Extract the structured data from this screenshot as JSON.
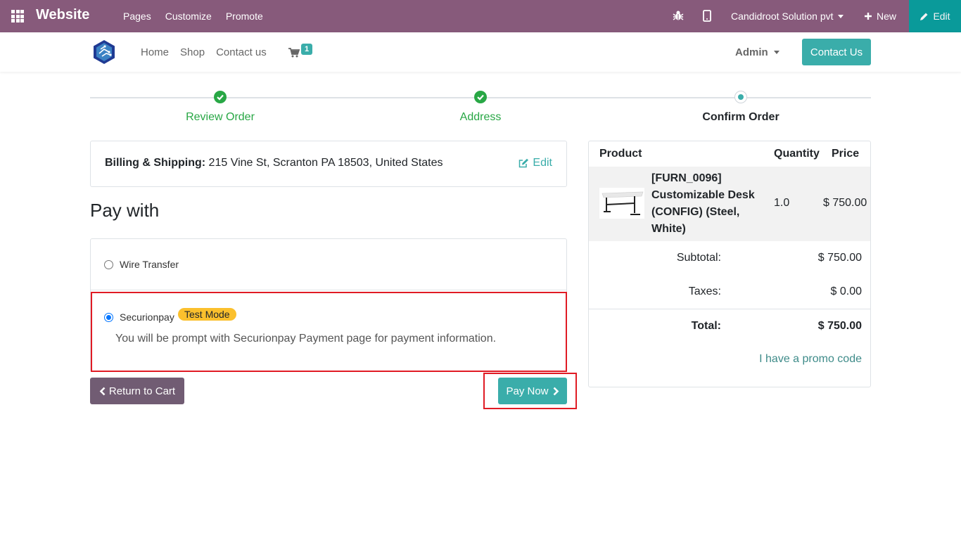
{
  "topbar": {
    "brand": "Website",
    "menu": [
      "Pages",
      "Customize",
      "Promote"
    ],
    "company": "Candidroot Solution pvt",
    "new_label": "New",
    "edit_label": "Edit"
  },
  "navbar": {
    "links": [
      "Home",
      "Shop",
      "Contact us"
    ],
    "cart_count": "1",
    "user": "Admin",
    "contact_button": "Contact Us"
  },
  "steps": [
    {
      "label": "Review Order",
      "state": "done"
    },
    {
      "label": "Address",
      "state": "done"
    },
    {
      "label": "Confirm Order",
      "state": "current"
    }
  ],
  "billing": {
    "title": "Billing & Shipping:",
    "address": "215 Vine St, Scranton PA 18503, United States",
    "edit_label": "Edit"
  },
  "pay_with": {
    "title": "Pay with",
    "options": [
      {
        "label": "Wire Transfer",
        "selected": false
      },
      {
        "label": "Securionpay",
        "selected": true,
        "badge": "Test Mode",
        "description": "You will be prompt with Securionpay Payment page for payment information."
      }
    ]
  },
  "buttons": {
    "return_label": "Return to Cart",
    "pay_label": "Pay Now"
  },
  "summary": {
    "headers": {
      "product": "Product",
      "quantity": "Quantity",
      "price": "Price"
    },
    "item": {
      "name": "[FURN_0096] Customizable Desk (CONFIG) (Steel, White)",
      "quantity": "1.0",
      "price": "$ 750.00"
    },
    "subtotal_label": "Subtotal:",
    "subtotal": "$ 750.00",
    "taxes_label": "Taxes:",
    "taxes": "$ 0.00",
    "total_label": "Total:",
    "total": "$ 750.00",
    "promo_label": "I have a promo code"
  },
  "colors": {
    "topbar": "#875a7b",
    "accent": "#3aadaa",
    "done": "#28a745",
    "highlight": "#e01b24"
  }
}
